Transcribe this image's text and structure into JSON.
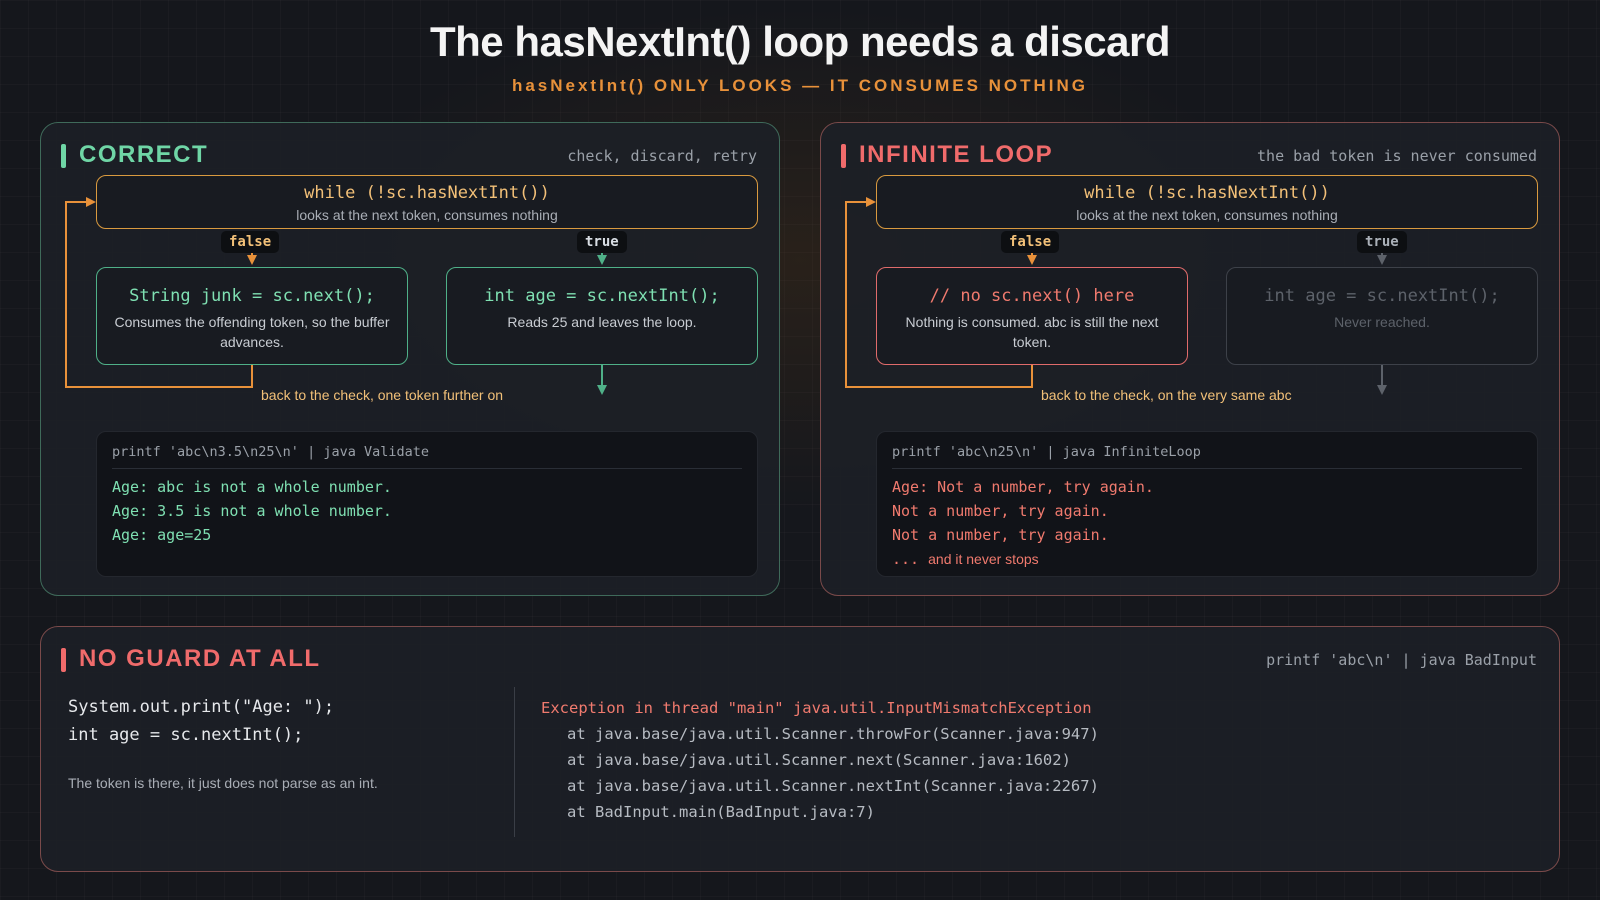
{
  "header": {
    "title": "The hasNextInt() loop needs a discard",
    "subtitle": "hasNextInt() ONLY LOOKS — IT CONSUMES NOTHING"
  },
  "correct": {
    "heading": "CORRECT",
    "note": "check, discard, retry",
    "while_code": "while (!sc.hasNextInt())",
    "while_sub": "looks at the next token, consumes nothing",
    "false_label": "false",
    "true_label": "true",
    "left_code": "String junk = sc.next();",
    "left_desc": "Consumes the offending token, so the buffer advances.",
    "right_code": "int age = sc.nextInt();",
    "right_desc": "Reads 25 and leaves the loop.",
    "back_label": "back to the check, one token further on",
    "terminal": {
      "command": "printf 'abc\\n3.5\\n25\\n' | java Validate",
      "lines": [
        "Age: abc is not a whole number.",
        "Age: 3.5 is not a whole number.",
        "Age: age=25"
      ]
    }
  },
  "infinite": {
    "heading": "INFINITE LOOP",
    "note": "the bad token is never consumed",
    "while_code": "while (!sc.hasNextInt())",
    "while_sub": "looks at the next token, consumes nothing",
    "false_label": "false",
    "true_label": "true",
    "left_code": "// no sc.next() here",
    "left_desc": "Nothing is consumed. abc is still the next token.",
    "right_code": "int age = sc.nextInt();",
    "right_desc": "Never reached.",
    "back_label": "back to the check, on the very same abc",
    "terminal": {
      "command": "printf 'abc\\n25\\n' | java InfiniteLoop",
      "lines": [
        "Age: Not a number, try again.",
        "Not a number, try again.",
        "Not a number, try again."
      ],
      "ellipsis": "...",
      "ellipsis_text": "and it never stops"
    }
  },
  "noguard": {
    "heading": "NO GUARD AT ALL",
    "command": "printf 'abc\\n' | java BadInput",
    "code": [
      "System.out.print(\"Age: \");",
      "int age = sc.nextInt();"
    ],
    "note": "The token is there, it just does not parse as an int.",
    "exception": [
      "Exception in thread \"main\" java.util.InputMismatchException",
      "at java.base/java.util.Scanner.throwFor(Scanner.java:947)",
      "at java.base/java.util.Scanner.next(Scanner.java:1602)",
      "at java.base/java.util.Scanner.nextInt(Scanner.java:2267)",
      "at BadInput.main(BadInput.java:7)"
    ]
  },
  "colors": {
    "green": "#6fd6a6",
    "red": "#f06b6b",
    "orange": "#e8913a",
    "amber": "#f2c078",
    "dim": "#5d626a"
  }
}
